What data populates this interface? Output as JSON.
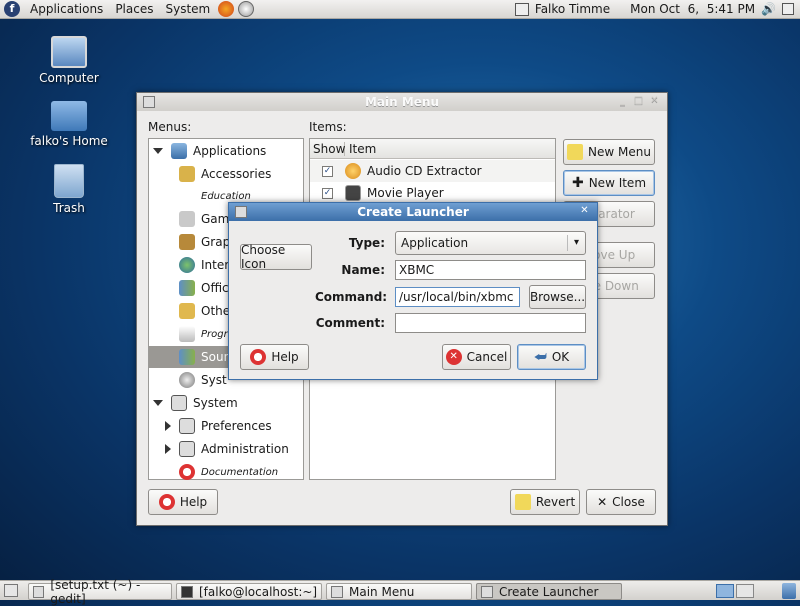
{
  "top_panel": {
    "menus": [
      "Applications",
      "Places",
      "System"
    ],
    "user": "Falko Timme",
    "datetime": "Mon Oct  6,  5:41 PM"
  },
  "desktop": {
    "icons": [
      {
        "label": "Computer"
      },
      {
        "label": "falko's Home"
      },
      {
        "label": "Trash"
      }
    ]
  },
  "main_menu": {
    "title": "Main Menu",
    "menus_label": "Menus:",
    "items_label": "Items:",
    "tree": [
      {
        "label": "Applications"
      },
      {
        "label": "Accessories"
      },
      {
        "label": "Education"
      },
      {
        "label": "Gam"
      },
      {
        "label": "Grap"
      },
      {
        "label": "Inter"
      },
      {
        "label": "Offic"
      },
      {
        "label": "Othe"
      },
      {
        "label": "Progr"
      },
      {
        "label": "Soun"
      },
      {
        "label": "Syst"
      },
      {
        "label": "System"
      },
      {
        "label": "Preferences"
      },
      {
        "label": "Administration"
      },
      {
        "label": "Documentation"
      }
    ],
    "columns": {
      "show": "Show",
      "item": "Item"
    },
    "items": [
      {
        "label": "Audio CD Extractor",
        "checked": true
      },
      {
        "label": "Movie Player",
        "checked": true
      }
    ],
    "buttons": {
      "new_menu": "New Menu",
      "new_item": "New Item",
      "separator": "eparator",
      "move_up": "Move Up",
      "move_down": "ove Down",
      "help": "Help",
      "revert": "Revert",
      "close": "Close"
    }
  },
  "create_launcher": {
    "title": "Create Launcher",
    "choose_icon": "Choose Icon",
    "type_label": "Type:",
    "type_value": "Application",
    "name_label": "Name:",
    "name_value": "XBMC",
    "command_label": "Command:",
    "command_value": "/usr/local/bin/xbmc",
    "browse": "Browse...",
    "comment_label": "Comment:",
    "comment_value": "",
    "help": "Help",
    "cancel": "Cancel",
    "ok": "OK"
  },
  "taskbar": {
    "tasks": [
      {
        "label": "[setup.txt (~) - gedit]"
      },
      {
        "label": "[falko@localhost:~]"
      },
      {
        "label": "Main Menu"
      },
      {
        "label": "Create Launcher"
      }
    ]
  },
  "colors": {
    "accent": "#3c6fa9",
    "selection": "#9a9894",
    "desktop": "#0e4a86"
  }
}
